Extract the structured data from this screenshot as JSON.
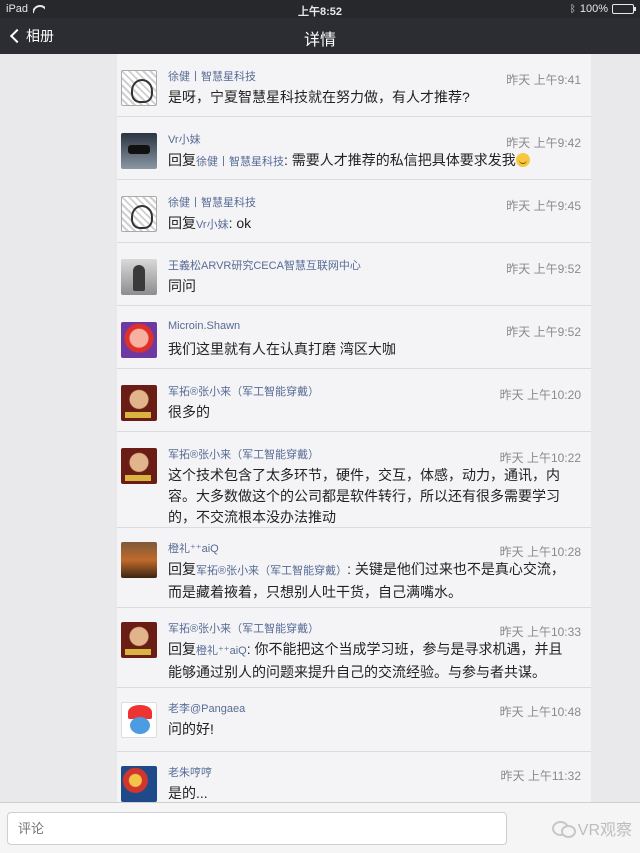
{
  "status_bar": {
    "device": "iPad",
    "time": "上午8:52",
    "battery": "100%",
    "battery_level": 1.0
  },
  "nav": {
    "back_label": "相册",
    "title": "详情"
  },
  "comments": [
    {
      "name": "徐健丨智慧星科技",
      "time": "昨天 上午9:41",
      "avatar": "avatar-manga",
      "text": "是呀，宁夏智慧星科技就在努力做，有人才推荐?"
    },
    {
      "name": "Vr小妹",
      "time": "昨天 上午9:42",
      "avatar": "avatar-vr-headset",
      "reply_prefix": "回复",
      "reply_to": "徐健丨智慧星科技",
      "text": ": 需要人才推荐的私信把具体要求发我",
      "emoji": "smile-emoji"
    },
    {
      "name": "徐健丨智慧星科技",
      "time": "昨天 上午9:45",
      "avatar": "avatar-manga",
      "reply_prefix": "回复",
      "reply_to": "Vr小妹",
      "text": ": ok"
    },
    {
      "name": "王義松ARVR研究CECA智慧互联网中心",
      "time": "昨天 上午9:52",
      "avatar": "avatar-person",
      "text": "同问"
    },
    {
      "name": "Microin.Shawn",
      "time": "昨天 上午9:52",
      "avatar": "avatar-cartoon",
      "text": "我们这里就有人在认真打磨 湾区大咖"
    },
    {
      "name": "军拓®张小来（军工智能穿戴）",
      "time": "昨天 上午10:20",
      "avatar": "avatar-zhang",
      "text": "很多的"
    },
    {
      "name": "军拓®张小来（军工智能穿戴）",
      "time": "昨天 上午10:22",
      "avatar": "avatar-zhang",
      "lines": [
        "这个技术包含了太多环节，硬件，交互，体感，动力，通讯，内",
        "容。大多数做这个的公司都是软件转行，所以还有很多需要学习",
        "的，不交流根本没办法推动"
      ]
    },
    {
      "name": "橙礼⁺⁺aiQ",
      "time": "昨天 上午10:28",
      "avatar": "avatar-food",
      "reply_prefix": "回复",
      "reply_to": "军拓®张小来（军工智能穿戴）",
      "lines": [
        ": 关键是他们过来也不是真心交流，",
        "而是藏着掖着，只想别人吐干货，自己满嘴水。"
      ]
    },
    {
      "name": "军拓®张小来（军工智能穿戴）",
      "time": "昨天 上午10:33",
      "avatar": "avatar-zhang",
      "reply_prefix": "回复",
      "reply_to": "橙礼⁺⁺aiQ",
      "lines": [
        ": 你不能把这个当成学习班，参与是寻求机遇，并且",
        "能够通过别人的问题来提升自己的交流经验。与参与者共谋。"
      ]
    },
    {
      "name": "老李@Pangaea",
      "time": "昨天 上午10:48",
      "avatar": "avatar-smurf",
      "text": "问的好!"
    },
    {
      "name": "老朱哼哼",
      "time": "昨天 上午11:32",
      "avatar": "avatar-colorful",
      "text": "是的..."
    }
  ],
  "bottom": {
    "input_placeholder": "评论",
    "watermark": "VR观察"
  }
}
